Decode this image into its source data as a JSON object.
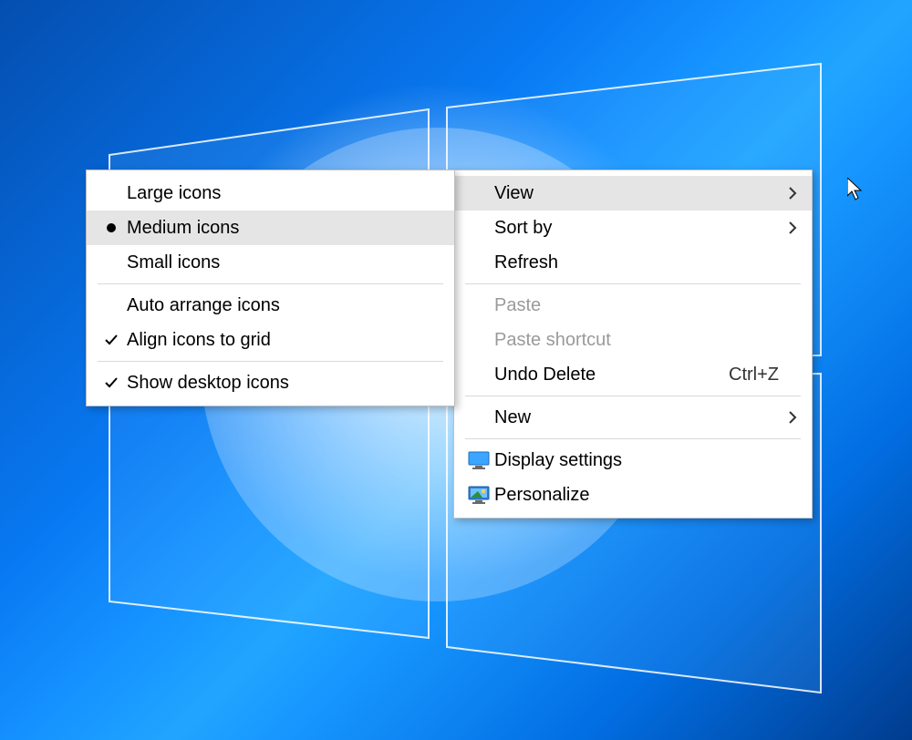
{
  "context_menu": {
    "items": [
      {
        "label": "View",
        "has_submenu": true,
        "hover": true
      },
      {
        "label": "Sort by",
        "has_submenu": true
      },
      {
        "label": "Refresh"
      },
      {
        "sep": true
      },
      {
        "label": "Paste",
        "disabled": true
      },
      {
        "label": "Paste shortcut",
        "disabled": true
      },
      {
        "label": "Undo Delete",
        "shortcut": "Ctrl+Z"
      },
      {
        "sep": true
      },
      {
        "label": "New",
        "has_submenu": true
      },
      {
        "sep": true
      },
      {
        "label": "Display settings",
        "icon": "monitor"
      },
      {
        "label": "Personalize",
        "icon": "monitor-color"
      }
    ]
  },
  "submenu_view": {
    "items": [
      {
        "label": "Large icons"
      },
      {
        "label": "Medium icons",
        "selected": true,
        "hover": true
      },
      {
        "label": "Small icons"
      },
      {
        "sep": true
      },
      {
        "label": "Auto arrange icons"
      },
      {
        "label": "Align icons to grid",
        "checked": true
      },
      {
        "sep": true
      },
      {
        "label": "Show desktop icons",
        "checked": true
      }
    ]
  }
}
